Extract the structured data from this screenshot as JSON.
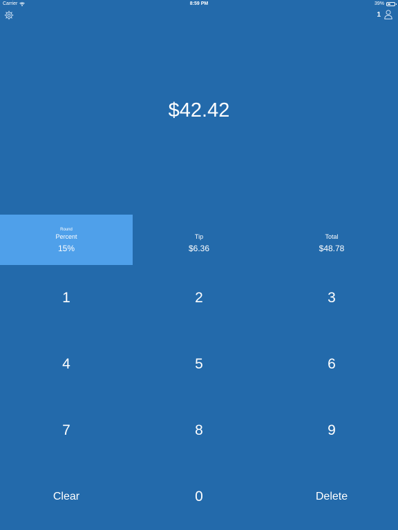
{
  "status_bar": {
    "carrier": "Carrier",
    "time": "8:59 PM",
    "battery": "39%",
    "battery_level": 0.39
  },
  "toolbar": {
    "settings_icon": "gear-icon",
    "people_count": "1",
    "people_icon": "person-icon"
  },
  "bill": {
    "amount": "$42.42"
  },
  "info": {
    "round_label": "Round",
    "percent_label": "Percent",
    "percent_value": "15%",
    "tip_label": "Tip",
    "tip_value": "$6.36",
    "total_label": "Total",
    "total_value": "$48.78"
  },
  "keypad": {
    "k1": "1",
    "k2": "2",
    "k3": "3",
    "k4": "4",
    "k5": "5",
    "k6": "6",
    "k7": "7",
    "k8": "8",
    "k9": "9",
    "clear": "Clear",
    "k0": "0",
    "delete": "Delete"
  },
  "colors": {
    "background": "#236aab",
    "selected_cell": "#4fa0ea",
    "text": "#ffffff"
  }
}
